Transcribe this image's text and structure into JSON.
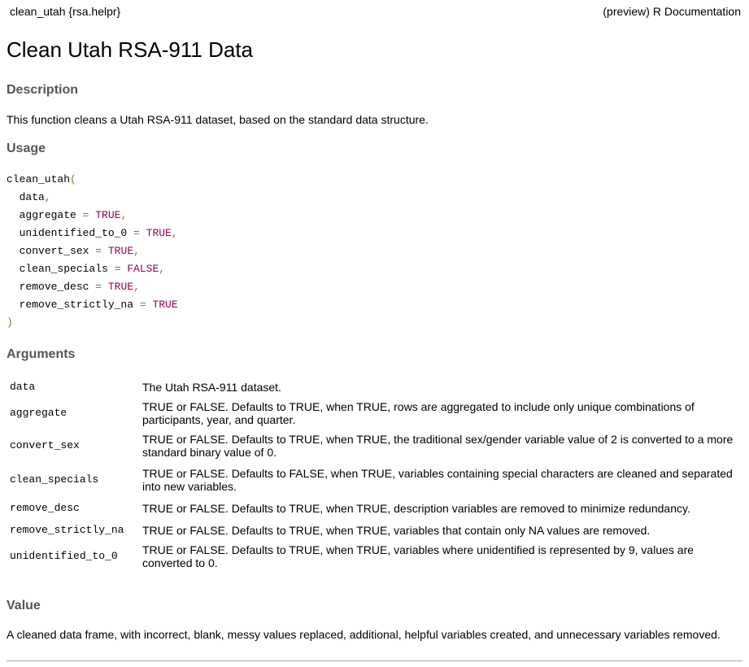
{
  "header": {
    "left": "clean_utah {rsa.helpr}",
    "right": "(preview) R Documentation"
  },
  "title": "Clean Utah RSA-911 Data",
  "description": {
    "heading": "Description",
    "text": "This function cleans a Utah RSA-911 dataset, based on the standard data structure."
  },
  "usage": {
    "heading": "Usage",
    "function": "clean_utah",
    "params": [
      {
        "name": "data",
        "value": null
      },
      {
        "name": "aggregate",
        "value": "TRUE"
      },
      {
        "name": "unidentified_to_0",
        "value": "TRUE"
      },
      {
        "name": "convert_sex",
        "value": "TRUE"
      },
      {
        "name": "clean_specials",
        "value": "FALSE"
      },
      {
        "name": "remove_desc",
        "value": "TRUE"
      },
      {
        "name": "remove_strictly_na",
        "value": "TRUE"
      }
    ]
  },
  "arguments": {
    "heading": "Arguments",
    "rows": [
      {
        "name": "data",
        "desc": "The Utah RSA-911 dataset."
      },
      {
        "name": "aggregate",
        "desc": "TRUE or FALSE. Defaults to TRUE, when TRUE, rows are aggregated to include only unique combinations of participants, year, and quarter."
      },
      {
        "name": "convert_sex",
        "desc": "TRUE or FALSE. Defaults to TRUE, when TRUE, the traditional sex/gender variable value of 2 is converted to a more standard binary value of 0."
      },
      {
        "name": "clean_specials",
        "desc": "TRUE or FALSE. Defaults to FALSE, when TRUE, variables containing special characters are cleaned and separated into new variables."
      },
      {
        "name": "remove_desc",
        "desc": "TRUE or FALSE. Defaults to TRUE, when TRUE, description variables are removed to minimize redundancy."
      },
      {
        "name": "remove_strictly_na",
        "desc": "TRUE or FALSE. Defaults to TRUE, when TRUE, variables that contain only NA values are removed."
      },
      {
        "name": "unidentified_to_0",
        "desc": "TRUE or FALSE. Defaults to TRUE, when TRUE, variables where unidentified is represented by 9, values are converted to 0."
      }
    ]
  },
  "value": {
    "heading": "Value",
    "text": "A cleaned data frame, with incorrect, blank, messy values replaced, additional, helpful variables created, and unnecessary variables removed."
  }
}
